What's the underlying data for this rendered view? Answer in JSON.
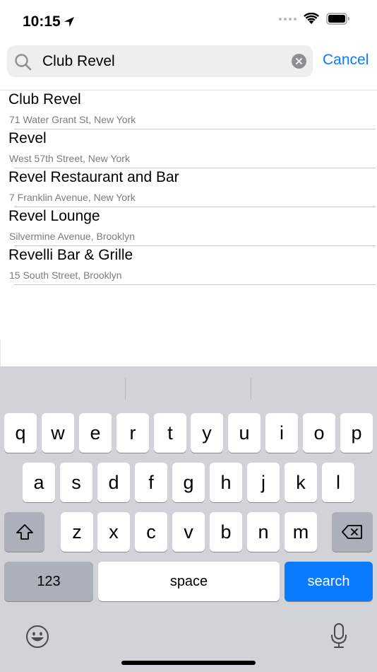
{
  "status_bar": {
    "time": "10:15",
    "icons": [
      "location-arrow-icon",
      "signal-dots-icon",
      "wifi-icon",
      "battery-icon"
    ]
  },
  "search": {
    "value": "Club Revel",
    "cancel_label": "Cancel",
    "icons": [
      "search-icon",
      "clear-icon"
    ]
  },
  "results": [
    {
      "title": "Club Revel",
      "subtitle": "71 Water Grant St, New York"
    },
    {
      "title": "Revel",
      "subtitle": "West 57th Street, New York"
    },
    {
      "title": "Revel Restaurant and Bar",
      "subtitle": "7 Franklin Avenue, New York"
    },
    {
      "title": "Revel Lounge",
      "subtitle": "Silvermine Avenue, Brooklyn"
    },
    {
      "title": "Revelli Bar & Grille",
      "subtitle": "15 South Street, Brooklyn"
    }
  ],
  "keyboard": {
    "row1": [
      "q",
      "w",
      "e",
      "r",
      "t",
      "y",
      "u",
      "i",
      "o",
      "p"
    ],
    "row2": [
      "a",
      "s",
      "d",
      "f",
      "g",
      "h",
      "j",
      "k",
      "l"
    ],
    "row3": [
      "z",
      "x",
      "c",
      "v",
      "b",
      "n",
      "m"
    ],
    "numbers_label": "123",
    "space_label": "space",
    "return_label": "search",
    "icons": [
      "shift-icon",
      "backspace-icon",
      "emoji-icon",
      "microphone-icon"
    ]
  },
  "colors": {
    "accent": "#0a7aff",
    "keyboard_bg": "#d1d3d9",
    "search_field_bg": "#eeeeef"
  }
}
